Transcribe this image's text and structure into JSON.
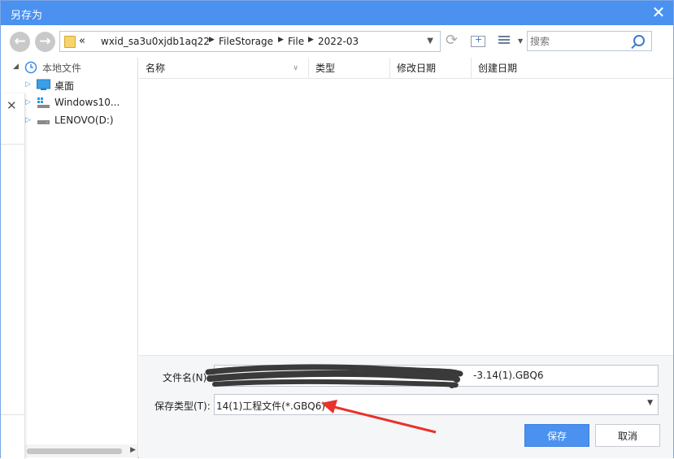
{
  "dialog": {
    "title": "另存为",
    "close_glyph": "✕"
  },
  "toolbar": {
    "back_glyph": "←",
    "forward_glyph": "→",
    "address": {
      "overflow": "«",
      "crumbs": [
        "wxid_sa3u0xjdb1aq22",
        "FileStorage",
        "File",
        "2022-03"
      ]
    },
    "refresh_glyph": "⟳",
    "search_placeholder": "搜索"
  },
  "nav_pane": {
    "items": [
      {
        "label": "本地文件",
        "icon": "clock-icon"
      },
      {
        "label": "桌面",
        "icon": "desktop-icon"
      },
      {
        "label": "Windows10...",
        "icon": "windows-drive-icon"
      },
      {
        "label": "LENOVO(D:)",
        "icon": "drive-icon"
      }
    ]
  },
  "side_overlay": {
    "close_glyph": "✕"
  },
  "list": {
    "columns": [
      "名称",
      "类型",
      "修改日期",
      "创建日期"
    ]
  },
  "form": {
    "filename_label": "文件名(N):",
    "filename_value": "-3.14(1).GBQ6",
    "filetype_label": "保存类型(T):",
    "filetype_value": "14(1)工程文件(*.GBQ6)"
  },
  "buttons": {
    "save": "保存",
    "cancel": "取消"
  },
  "colors": {
    "accent": "#4b91f0",
    "annotation_arrow": "#e8322b",
    "redaction": "#3a3a3a"
  }
}
